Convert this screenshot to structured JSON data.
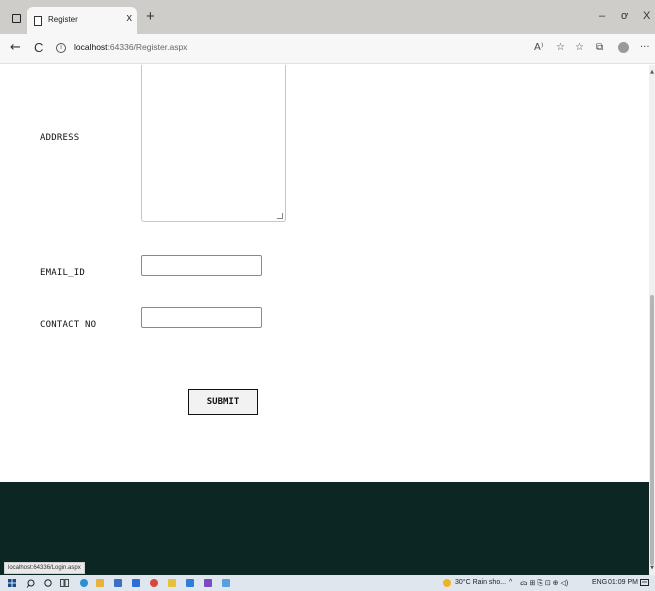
{
  "browser": {
    "tab_title": "Register",
    "tab_close": "x",
    "new_tab": "+",
    "window_controls": {
      "minimize": "–",
      "restore": "ơ",
      "close": "X"
    },
    "nav": {
      "back": "←",
      "refresh": "C"
    },
    "url_host": "localhost",
    "url_rest": ":64336/Register.aspx",
    "toolbar_icons": [
      "read-aloud-icon",
      "favorite-add-icon",
      "favorites-icon",
      "collections-icon",
      "profile-icon",
      "more-icon"
    ],
    "toolbar_glyphs": {
      "read_aloud": "A⁾",
      "favorite": "☆",
      "favorites": "☆",
      "collections": "⧉",
      "more": "···"
    },
    "status_url": "localhost:64336/Login.aspx"
  },
  "form": {
    "address_label": "ADDRESS",
    "address_value": "",
    "email_label": "EMAIL_ID",
    "email_value": "",
    "contact_label": "CONTACT NO",
    "contact_value": "",
    "submit_label": "SUBMIT"
  },
  "colors": {
    "footer": "#0b2623",
    "tab_strip": "#cfcdca",
    "taskbar": "#dfe6ee"
  },
  "taskbar": {
    "weather": "30°C  Rain sho...",
    "language": "ENG",
    "time": "01:09 PM",
    "apps": [
      "start-icon",
      "search-icon",
      "cortana-icon",
      "task-view-icon",
      "edge-icon",
      "file-explorer-icon",
      "store-icon",
      "mail-icon",
      "chrome-icon",
      "vscode-icon",
      "visual-studio-icon",
      "notepad-icon"
    ]
  }
}
